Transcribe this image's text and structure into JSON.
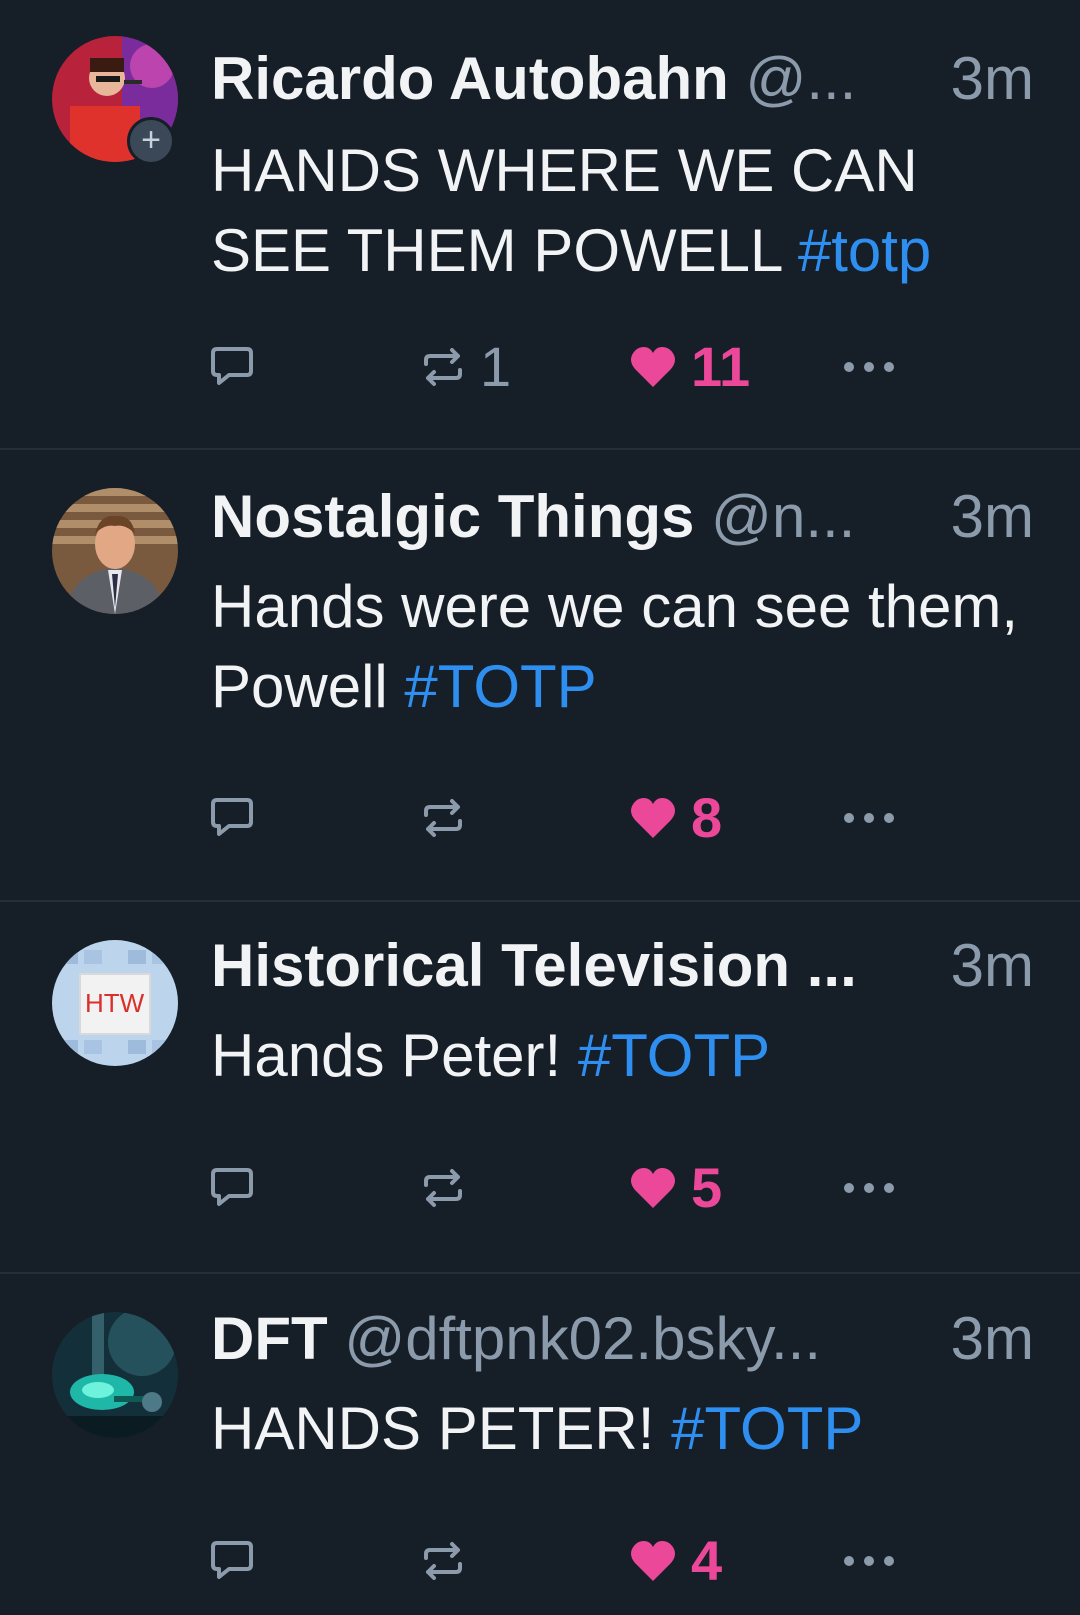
{
  "colors": {
    "background": "#161e27",
    "text": "#f1f3f5",
    "muted": "#8c9bab",
    "hashtag": "#2e8ff0",
    "like": "#ec4899",
    "divider": "#232f3b"
  },
  "posts": [
    {
      "name": "Ricardo Autobahn",
      "handle": "@...",
      "time": "3m",
      "text": "HANDS WHERE WE CAN SEE THEM POWELL",
      "hashtag": "#totp",
      "repost_count": "1",
      "like_count": "11",
      "follow_badge": "+",
      "avatar_icon": "avatar-red-performer"
    },
    {
      "name": "Nostalgic Things",
      "handle": "@n...",
      "time": "3m",
      "text": "Hands were we can see them, Powell",
      "hashtag": "#TOTP",
      "repost_count": "",
      "like_count": "8",
      "avatar_icon": "avatar-man-in-suit"
    },
    {
      "name": "Historical Television ...",
      "handle": "",
      "time": "3m",
      "text": "Hands Peter!",
      "hashtag": "#TOTP",
      "repost_count": "",
      "like_count": "5",
      "avatar_logo_text": "HTW",
      "avatar_icon": "avatar-htw-logo"
    },
    {
      "name": "DFT",
      "handle": "@dftpnk02.bsky...",
      "time": "3m",
      "text": "HANDS PETER!",
      "hashtag": "#TOTP",
      "repost_count": "",
      "like_count": "4",
      "avatar_icon": "avatar-teal-scene"
    }
  ],
  "icons": {
    "reply": "reply-icon",
    "repost": "repost-icon",
    "like": "heart-icon",
    "more": "more-dots-icon"
  }
}
